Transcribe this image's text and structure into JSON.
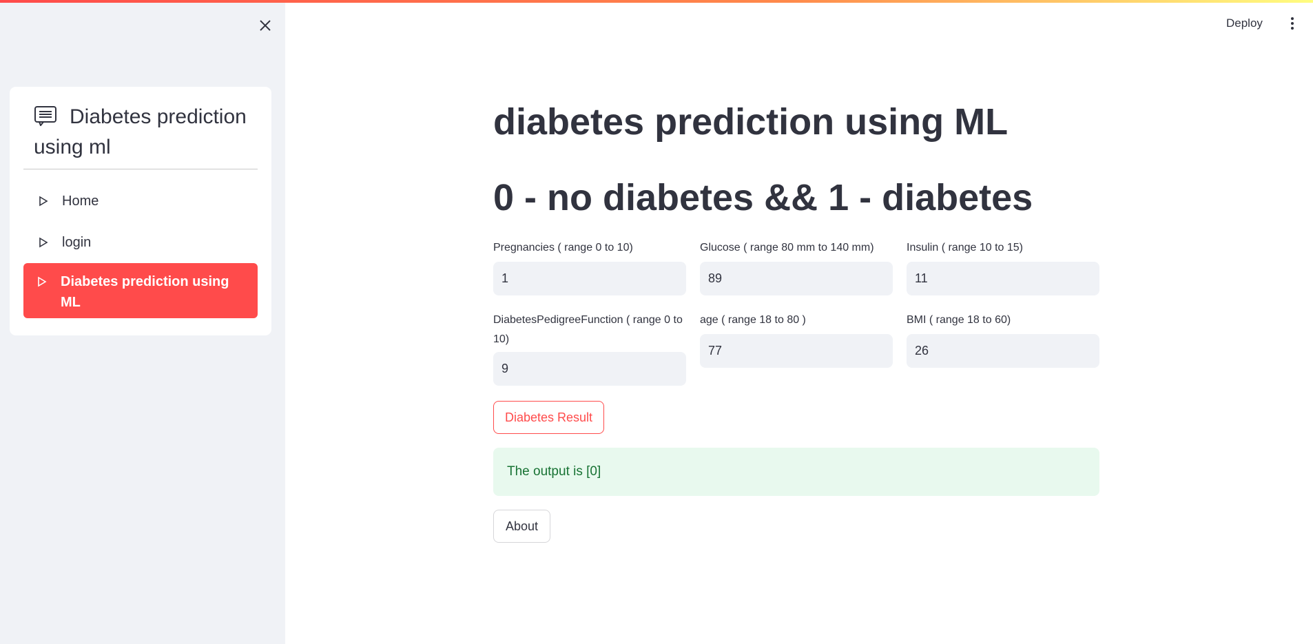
{
  "sidebar": {
    "menu_title": "Diabetes prediction using ml",
    "items": [
      {
        "label": "Home"
      },
      {
        "label": "login"
      },
      {
        "label": "Diabetes prediction using ML"
      }
    ],
    "active_color": "#ff4b4b"
  },
  "header": {
    "deploy_label": "Deploy"
  },
  "main": {
    "title": "diabetes prediction using ML",
    "subtitle": "0 - no diabetes && 1 - diabetes",
    "fields": {
      "pregnancies": {
        "label": "Pregnancies ( range 0 to 10)",
        "value": "1"
      },
      "glucose": {
        "label": "Glucose ( range 80 mm to 140 mm)",
        "value": "89"
      },
      "insulin": {
        "label": "Insulin ( range 10 to 15)",
        "value": "11"
      },
      "dpf": {
        "label": "DiabetesPedigreeFunction ( range 0 to 10)",
        "value": "9"
      },
      "age": {
        "label": "age ( range 18 to 80 )",
        "value": "77"
      },
      "bmi": {
        "label": "BMI ( range 18 to 60)",
        "value": "26"
      }
    },
    "result_button": "Diabetes Result",
    "output_text": "The output is [0]",
    "about_button": "About"
  },
  "icons": {
    "close": "close-icon",
    "menu_title": "document-icon",
    "menu_item": "play-triangle-icon",
    "more": "kebab-menu-icon"
  },
  "colors": {
    "accent": "#ff4b4b",
    "success_bg": "#e8f9ee",
    "success_text": "#177233",
    "sidebar_bg": "#f0f2f6"
  }
}
